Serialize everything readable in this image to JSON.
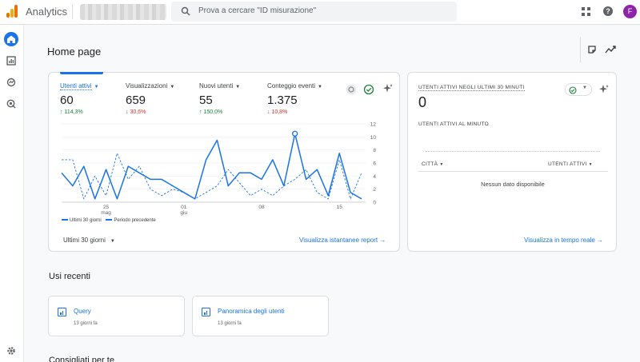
{
  "app": {
    "name": "Analytics"
  },
  "search": {
    "placeholder": "Prova a cercare \"ID misurazione\""
  },
  "user": {
    "avatar_letter": "F",
    "avatar_color": "#8e24aa"
  },
  "colors": {
    "accent": "#1a73e8",
    "up": "#188038",
    "down": "#d93025"
  },
  "page": {
    "title": "Home page"
  },
  "metrics": [
    {
      "label": "Utenti attivi",
      "value": "60",
      "change": "114,3%",
      "direction": "up"
    },
    {
      "label": "Visualizzazioni",
      "value": "659",
      "change": "30,6%",
      "direction": "down"
    },
    {
      "label": "Nuovi utenti",
      "value": "55",
      "change": "150,0%",
      "direction": "up"
    },
    {
      "label": "Conteggio eventi",
      "value": "1.375",
      "change": "10,8%",
      "direction": "down"
    }
  ],
  "chart_data": {
    "type": "line",
    "x_ticks": [
      {
        "index": 4,
        "label": "25",
        "sublabel": "mag"
      },
      {
        "index": 11,
        "label": "01",
        "sublabel": "giu"
      },
      {
        "index": 18,
        "label": "08",
        "sublabel": ""
      },
      {
        "index": 25,
        "label": "15",
        "sublabel": ""
      }
    ],
    "y_ticks": [
      0,
      2,
      4,
      6,
      8,
      10,
      12
    ],
    "ylim": [
      0,
      12
    ],
    "series": [
      {
        "name": "Ultimi 30 giorni",
        "style": "solid",
        "values": [
          4.5,
          2.5,
          5.5,
          0.5,
          5,
          0.5,
          5.5,
          4.5,
          3.5,
          3.5,
          2.5,
          1.5,
          0.5,
          6.5,
          9.5,
          2.5,
          4.5,
          4.5,
          3.5,
          6.5,
          2.5,
          10.5,
          3.5,
          5,
          1,
          7.5,
          1.5,
          0.5
        ]
      },
      {
        "name": "Periodo precedente",
        "style": "dashed",
        "values": [
          6.5,
          6.5,
          0.5,
          4,
          1,
          7.5,
          3.5,
          5.5,
          2,
          1,
          2,
          1.5,
          0.5,
          1.5,
          2.5,
          5,
          3,
          1,
          2,
          1,
          2.5,
          3.5,
          5,
          1.5,
          0.5,
          6.5,
          0.5,
          4.5
        ]
      }
    ],
    "highlight_index": 21
  },
  "legend": {
    "current": "Ultimi 30 giorni",
    "previous": "Periodo precedente"
  },
  "range_selector": "Ultimi 30 giorni",
  "report_link": "Visualizza istantanee report",
  "realtime": {
    "title": "UTENTI ATTIVI NEGLI ULTIMI 30 MINUTI",
    "value": "0",
    "subtitle": "UTENTI ATTIVI AL MINUTO",
    "col_city": "CITTÀ",
    "col_users": "UTENTI ATTIVI",
    "empty": "Nessun dato disponibile",
    "link": "Visualizza in tempo reale"
  },
  "recent": {
    "title": "Usi recenti",
    "items": [
      {
        "label": "Query",
        "time": "13 giorni fa"
      },
      {
        "label": "Panoramica degli utenti",
        "time": "13 giorni fa"
      }
    ]
  },
  "suggested": {
    "title": "Consigliati per te"
  }
}
